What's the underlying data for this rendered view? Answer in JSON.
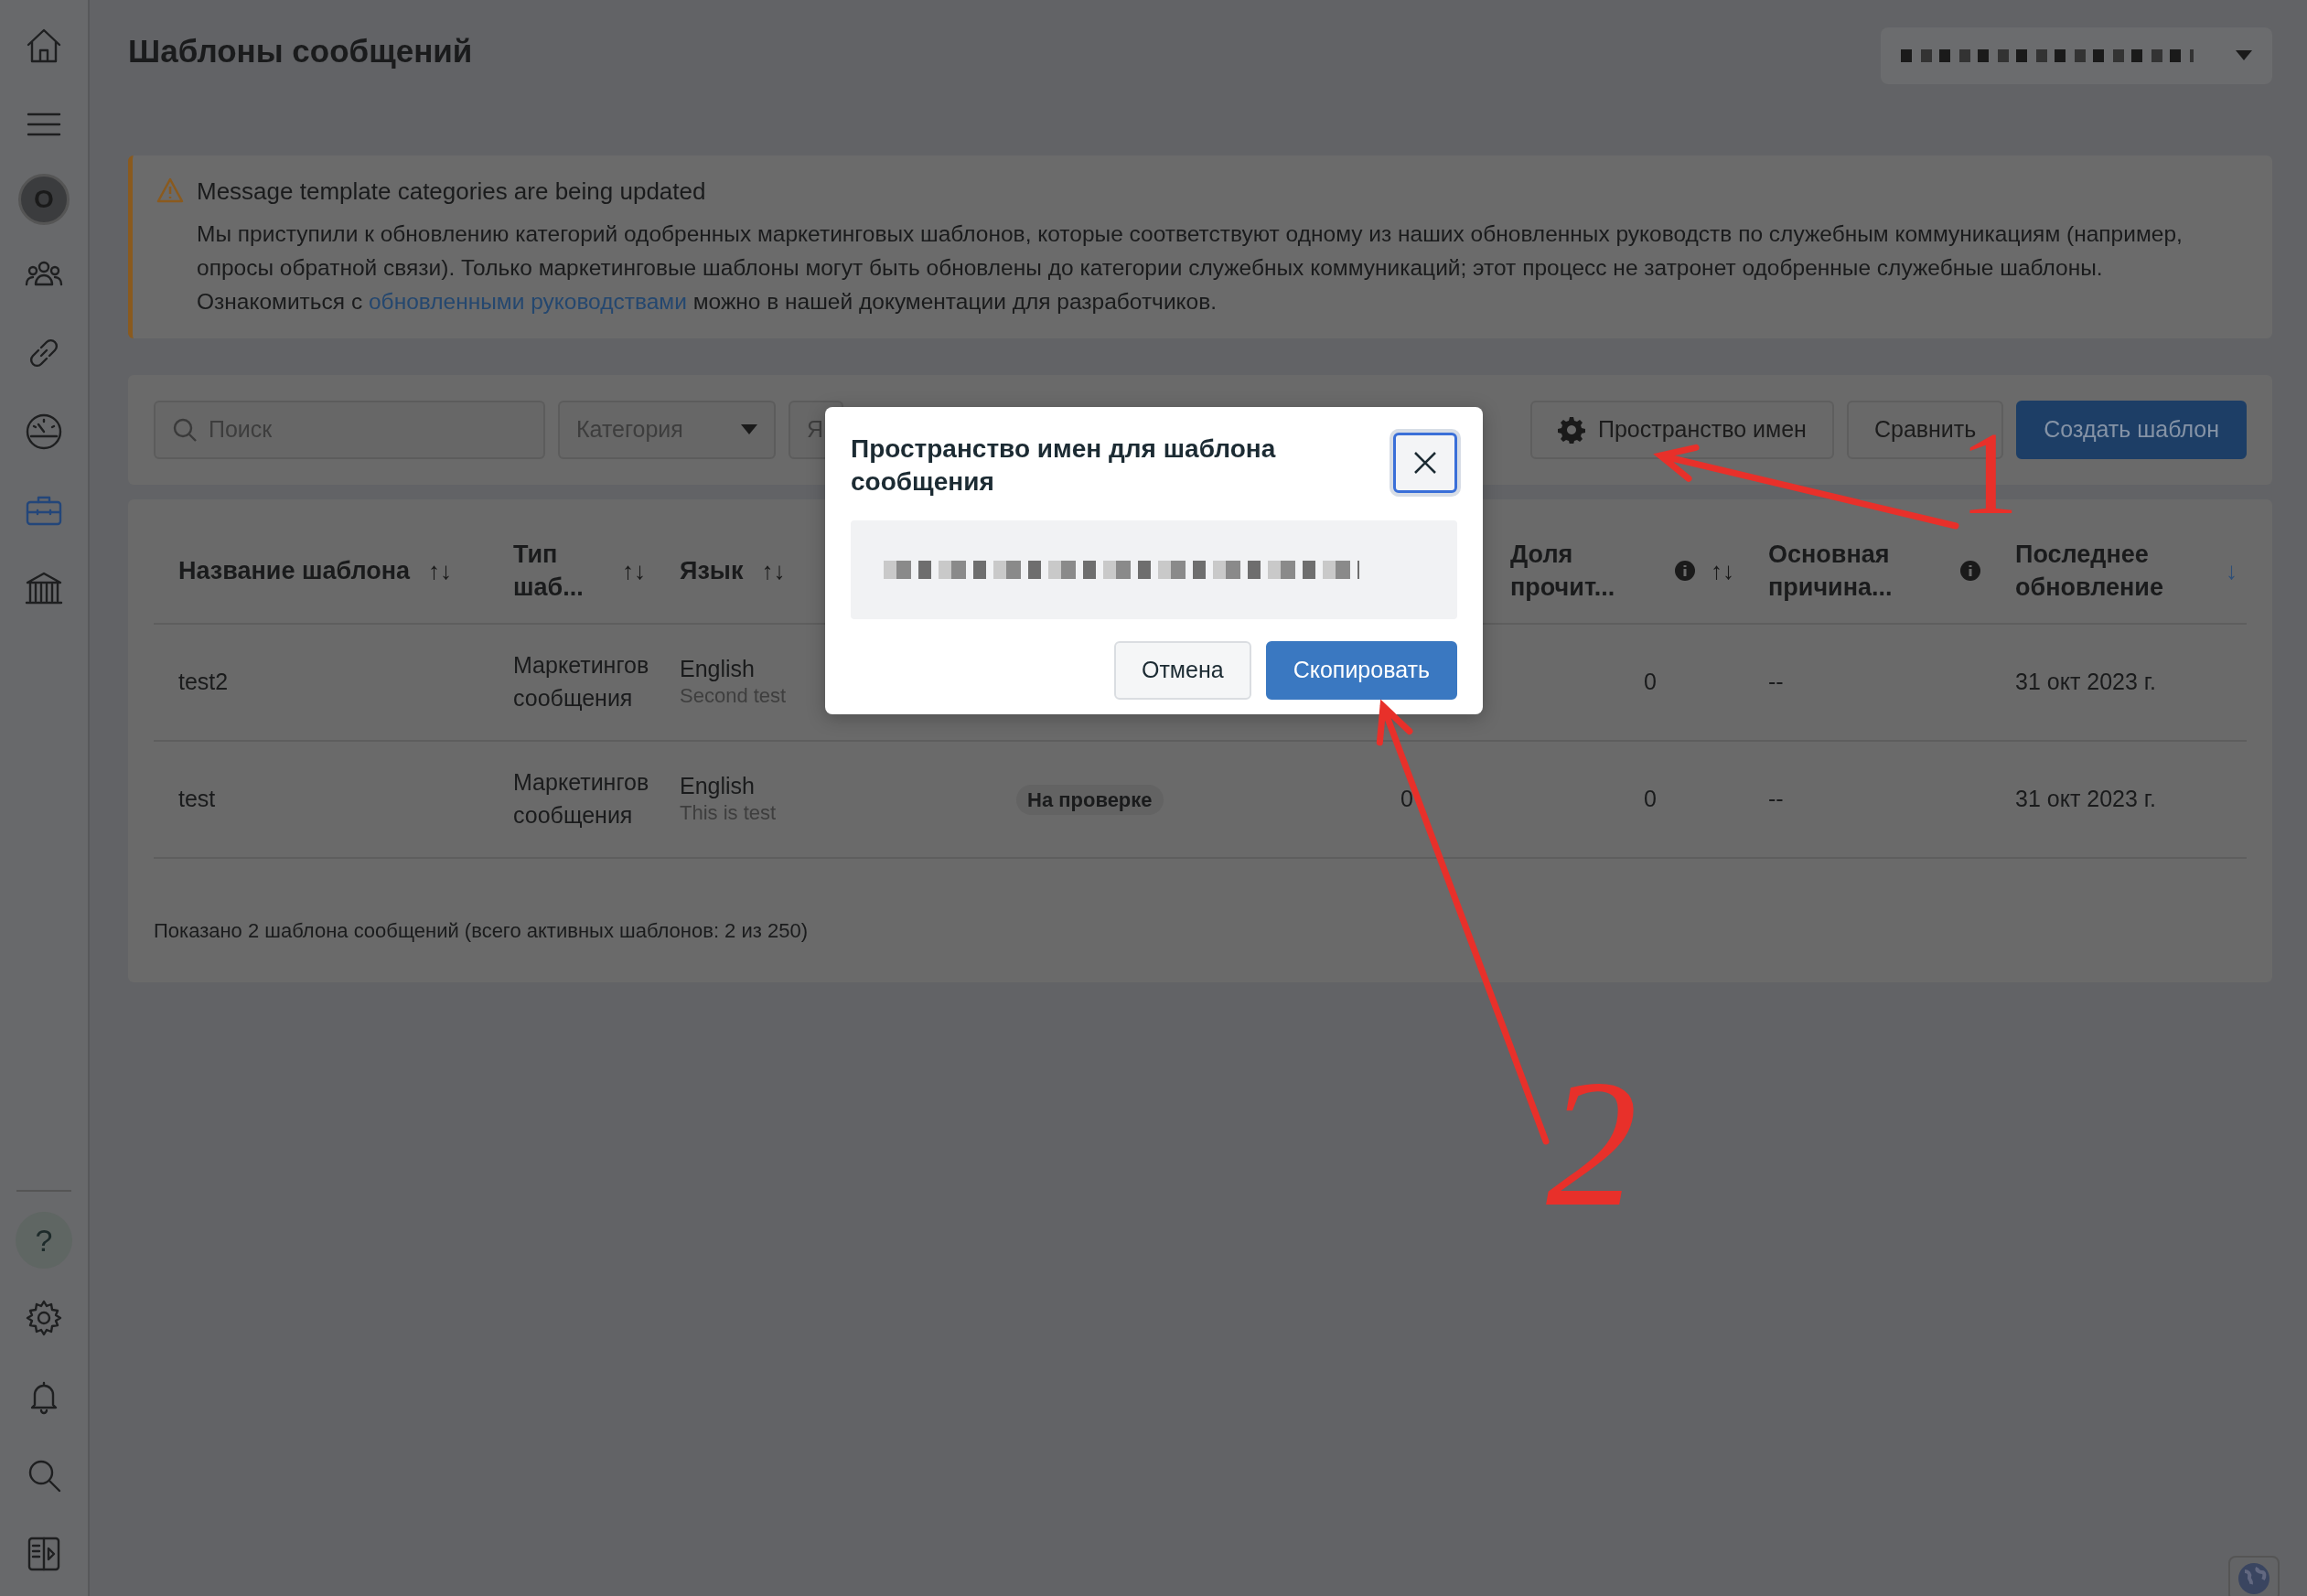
{
  "sidebar": {
    "items": [
      {
        "kind": "icon",
        "selected": false
      },
      {
        "kind": "icon",
        "selected": false
      },
      {
        "kind": "avatar",
        "text": "O",
        "selected": false
      },
      {
        "kind": "icon",
        "selected": false
      },
      {
        "kind": "icon",
        "selected": false
      },
      {
        "kind": "icon",
        "selected": false
      },
      {
        "kind": "icon",
        "selected": true
      },
      {
        "kind": "icon",
        "selected": false
      }
    ],
    "bottom_items": [
      {
        "kind": "help",
        "text": "?"
      },
      {
        "kind": "icon"
      },
      {
        "kind": "icon"
      },
      {
        "kind": "icon"
      },
      {
        "kind": "icon"
      }
    ]
  },
  "page": {
    "title": "Шаблоны сообщений"
  },
  "notice": {
    "title": "Message template categories are being updated",
    "text": "Мы приступили к обновлению категорий одобренных маркетинговых шаблонов, которые соответствуют одному из наших обновленных руководств по служебным коммуникациям (например, опросы обратной связи). Только маркетинговые шаблоны могут быть обновлены до категории служебных коммуникаций; этот процесс не затронет одобренные служебные шаблоны. Ознакомиться с ",
    "link": "обновленными руководствами",
    "text_after": " можно в нашей документации для разработчиков."
  },
  "toolbar": {
    "search": {
      "placeholder": "Поиск"
    },
    "filters": [
      "Категория",
      "Я"
    ],
    "buttons": [
      {
        "kind": "icon",
        "label": "Пространство имен"
      },
      {
        "kind": "secondary",
        "label": "Сравнить"
      },
      {
        "kind": "primary",
        "label": "Создать шаблон"
      }
    ]
  },
  "table": {
    "columns": [
      {
        "label": "Название шаблона",
        "sort": "↑↓"
      },
      {
        "label": "Тип шаб...",
        "sort": "↑↓"
      },
      {
        "label": "Язык",
        "sort": "↑↓"
      },
      {},
      {},
      {
        "label": "Доля прочит...",
        "sort": "↑↓",
        "info": true
      },
      {
        "label": "Основная причина...",
        "info": true
      },
      {
        "label": "Последнее обновление",
        "sort": "↓",
        "sorted": true
      }
    ],
    "rows": [
      {
        "name": "test2",
        "type": "Маркетингов\nсообщения",
        "language": "English",
        "description": "Second test",
        "read_rate": "0",
        "reason": "--",
        "updated": "31 окт 2023 г."
      },
      {
        "name": "test",
        "type": "Маркетингов\nсообщения",
        "language": "English",
        "description": "This is test",
        "status": "На проверке",
        "column_5": "0",
        "read_rate": "0",
        "reason": "--",
        "updated": "31 окт 2023 г."
      }
    ],
    "footer": "Показано 2 шаблона сообщений (всего активных шаблонов: 2 из 250)"
  },
  "modal": {
    "title": "Пространство имен для шаблона сообщения",
    "close_focused": true,
    "buttons": [
      {
        "kind": "secondary",
        "label": "Отмена"
      },
      {
        "kind": "primary",
        "label": "Скопировать"
      }
    ]
  },
  "annotations": [
    {
      "text": "1"
    },
    {
      "text": "2"
    }
  ]
}
